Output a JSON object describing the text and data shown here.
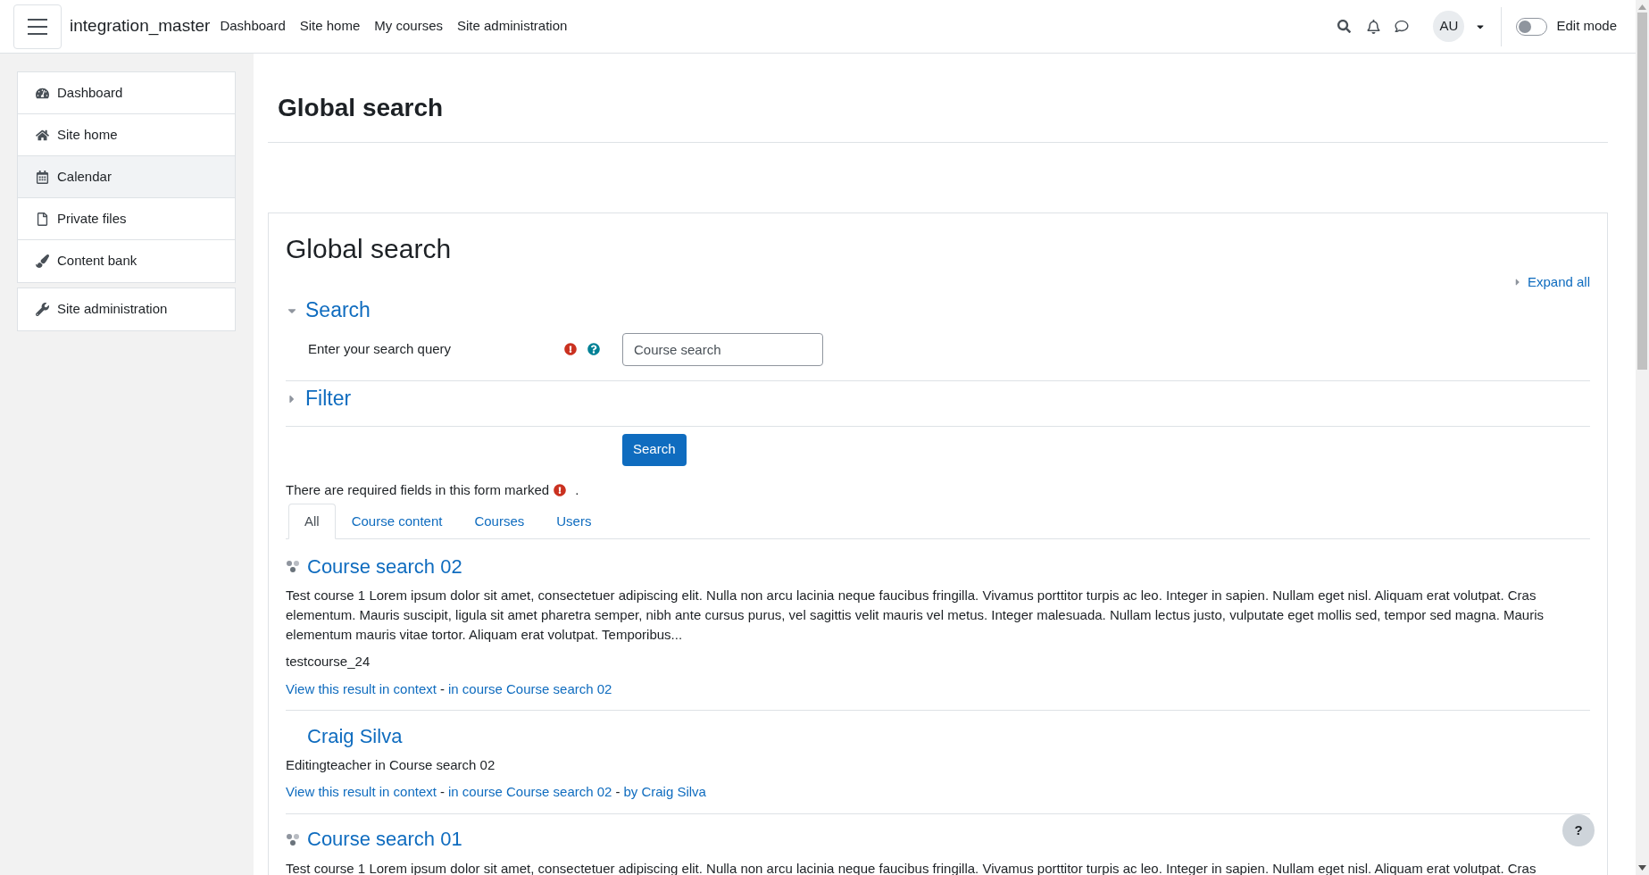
{
  "navbar": {
    "brand": "integration_master",
    "links": [
      "Dashboard",
      "Site home",
      "My courses",
      "Site administration"
    ],
    "avatar": "AU",
    "edit_mode": {
      "label": "Edit mode",
      "on": false
    }
  },
  "sidebar": {
    "groups": [
      [
        {
          "label": "Dashboard",
          "selected": false
        },
        {
          "label": "Site home",
          "selected": false
        },
        {
          "label": "Calendar",
          "selected": true
        },
        {
          "label": "Private files",
          "selected": false
        },
        {
          "label": "Content bank",
          "selected": false
        }
      ],
      [
        {
          "label": "Site administration",
          "selected": false
        }
      ]
    ]
  },
  "page_title": "Global search",
  "card": {
    "title": "Global search",
    "expand_all": "Expand all",
    "sections": [
      {
        "title": "Search",
        "expanded": true,
        "fields": [
          {
            "label": "Enter your search query",
            "required": true,
            "value": "Course search"
          }
        ]
      },
      {
        "title": "Filter",
        "expanded": false
      }
    ],
    "button": "Search",
    "required_note": {
      "before": "There are required fields in this form marked",
      "after": "."
    },
    "tabs": [
      {
        "label": "All",
        "selected": true
      },
      {
        "label": "Course content",
        "selected": false
      },
      {
        "label": "Courses",
        "selected": false
      },
      {
        "label": "Users",
        "selected": false
      }
    ],
    "results": [
      {
        "kind": "course",
        "title": "Course search 02",
        "description": "Test course 1 Lorem ipsum dolor sit amet, consectetuer adipiscing elit. Nulla non arcu lacinia neque faucibus fringilla. Vivamus porttitor turpis ac leo. Integer in sapien. Nullam eget nisl. Aliquam erat volutpat. Cras elementum. Mauris suscipit, ligula sit amet pharetra semper, nibh ante cursus purus, vel sagittis velit mauris vel metus. Integer malesuada. Nullam lectus justo, vulputate eget mollis sed, tempor sed magna. Mauris elementum mauris vitae tortor. Aliquam erat volutpat. Temporibus...",
        "extra": "testcourse_24",
        "links": [
          "View this result in context",
          "in course Course search 02"
        ]
      },
      {
        "kind": "user",
        "title": "Craig Silva",
        "description": "Editingteacher in Course search 02",
        "links": [
          "View this result in context",
          "in course Course search 02",
          "by Craig Silva"
        ]
      },
      {
        "kind": "course",
        "title": "Course search 01",
        "description": "Test course 1 Lorem ipsum dolor sit amet, consectetuer adipiscing elit. Nulla non arcu lacinia neque faucibus fringilla. Vivamus porttitor turpis ac leo. Integer in sapien. Nullam eget nisl. Aliquam erat volutpat. Cras"
      }
    ],
    "link_separator": "-"
  },
  "help_button": "?"
}
